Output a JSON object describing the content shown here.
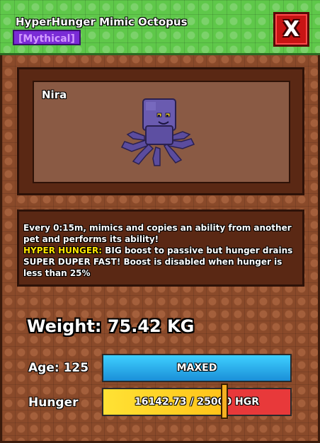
{
  "header": {
    "title": "HyperHunger Mimic Octopus",
    "rarity": "[Mythical]",
    "close_label": "X"
  },
  "pet": {
    "name": "Nira",
    "icon": "octopus-icon"
  },
  "description": {
    "line1": "Every 0:15m, mimics and copies an ability from another pet and performs its ability!",
    "ability_name": "HYPER HUNGER:",
    "ability_text": " BIG boost to passive but hunger drains SUPER DUPER FAST! Boost is disabled when hunger is less than 25%"
  },
  "stats": {
    "weight": "Weight: 75.42 KG",
    "age_label": "Age: 125",
    "age_value": "MAXED",
    "hunger_label": "Hunger",
    "hunger_value": "16142.73 / 25000 HGR",
    "hunger_fraction": 0.6457
  },
  "colors": {
    "header_green": "#5fc84a",
    "rarity_purple": "#7a2bd6",
    "close_red": "#c81414",
    "panel_brown": "#8a4a2a",
    "age_blue": "#3ed0ff",
    "hunger_yellow": "#ffe234",
    "hunger_red": "#e8393a",
    "ability_yellow": "#ffe600"
  }
}
